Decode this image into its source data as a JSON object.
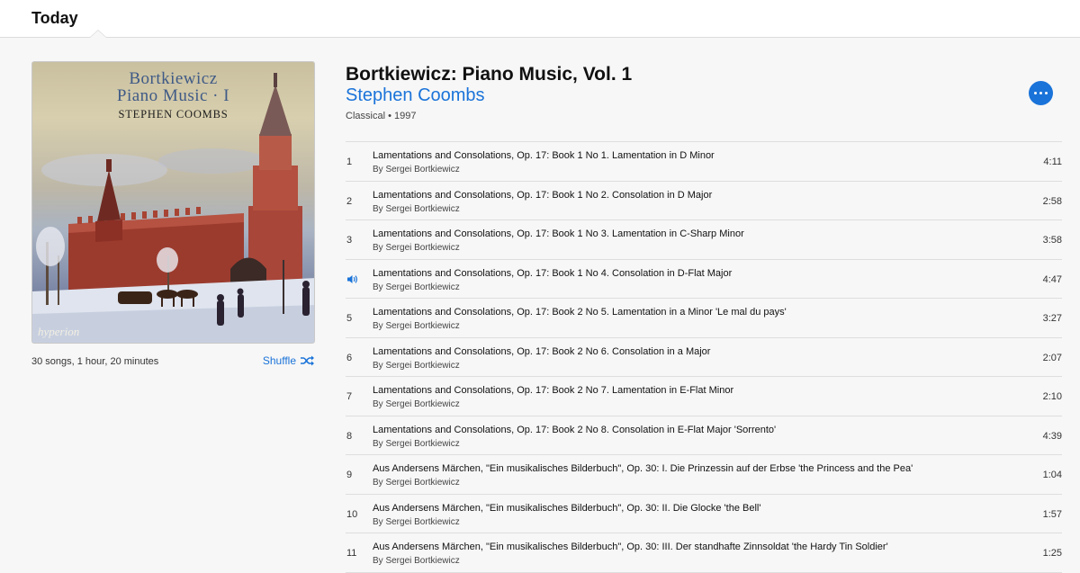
{
  "header": {
    "title": "Today"
  },
  "album": {
    "art_line1": "Bortkiewicz",
    "art_line2": "Piano Music · I",
    "art_line3": "STEPHEN COOMBS",
    "art_label": "hyperion",
    "title": "Bortkiewicz: Piano Music, Vol. 1",
    "artist": "Stephen Coombs",
    "info": "Classical • 1997",
    "summary": "30 songs, 1 hour, 20 minutes",
    "shuffle_label": "Shuffle"
  },
  "colors": {
    "accent": "#1a73d9"
  },
  "tracks": [
    {
      "num": "1",
      "title": "Lamentations and Consolations, Op. 17: Book 1 No 1. Lamentation in D Minor",
      "by": "By Sergei Bortkiewicz",
      "duration": "4:11",
      "playing": false
    },
    {
      "num": "2",
      "title": "Lamentations and Consolations, Op. 17: Book 1 No 2. Consolation in D Major",
      "by": "By Sergei Bortkiewicz",
      "duration": "2:58",
      "playing": false
    },
    {
      "num": "3",
      "title": "Lamentations and Consolations, Op. 17: Book 1 No 3. Lamentation in C-Sharp Minor",
      "by": "By Sergei Bortkiewicz",
      "duration": "3:58",
      "playing": false
    },
    {
      "num": "",
      "title": "Lamentations and Consolations, Op. 17: Book 1 No 4. Consolation in D-Flat Major",
      "by": "By Sergei Bortkiewicz",
      "duration": "4:47",
      "playing": true
    },
    {
      "num": "5",
      "title": "Lamentations and Consolations, Op. 17: Book 2 No 5. Lamentation in a Minor 'Le mal du pays'",
      "by": "By Sergei Bortkiewicz",
      "duration": "3:27",
      "playing": false
    },
    {
      "num": "6",
      "title": "Lamentations and Consolations, Op. 17: Book 2 No 6. Consolation in a Major",
      "by": "By Sergei Bortkiewicz",
      "duration": "2:07",
      "playing": false
    },
    {
      "num": "7",
      "title": "Lamentations and Consolations, Op. 17: Book 2 No 7. Lamentation in E-Flat Minor",
      "by": "By Sergei Bortkiewicz",
      "duration": "2:10",
      "playing": false
    },
    {
      "num": "8",
      "title": "Lamentations and Consolations, Op. 17: Book 2 No 8. Consolation in E-Flat Major 'Sorrento'",
      "by": "By Sergei Bortkiewicz",
      "duration": "4:39",
      "playing": false
    },
    {
      "num": "9",
      "title": "Aus Andersens Märchen, \"Ein musikalisches Bilderbuch\", Op. 30: I. Die Prinzessin auf der Erbse 'the Princess and the Pea'",
      "by": "By Sergei Bortkiewicz",
      "duration": "1:04",
      "playing": false
    },
    {
      "num": "10",
      "title": "Aus Andersens Märchen, \"Ein musikalisches Bilderbuch\", Op. 30: II. Die Glocke 'the Bell'",
      "by": "By Sergei Bortkiewicz",
      "duration": "1:57",
      "playing": false
    },
    {
      "num": "11",
      "title": "Aus Andersens Märchen, \"Ein musikalisches Bilderbuch\", Op. 30: III. Der standhafte Zinnsoldat 'the Hardy Tin Soldier'",
      "by": "By Sergei Bortkiewicz",
      "duration": "1:25",
      "playing": false
    }
  ]
}
